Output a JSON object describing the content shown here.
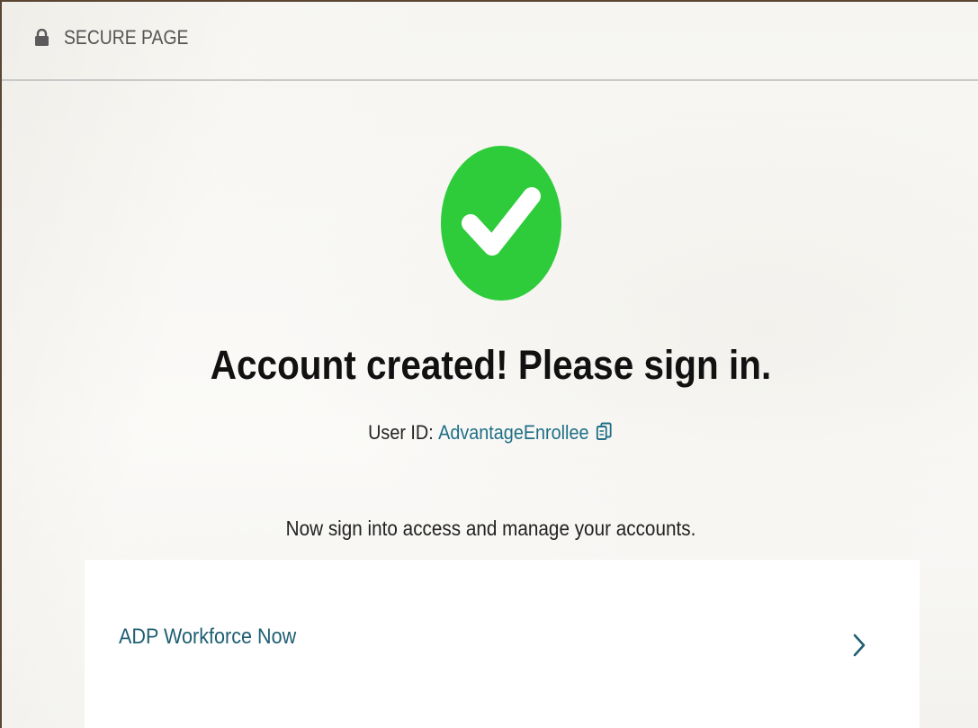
{
  "header": {
    "secure_label": "SECURE PAGE",
    "icon": "lock-icon"
  },
  "status": {
    "icon": "check-circle-icon",
    "color": "#2ecc3a"
  },
  "main": {
    "title": "Account created! Please sign in.",
    "user_id_label": "User ID:",
    "user_id_value": "AdvantageEnrollee",
    "copy_icon": "copy-icon",
    "subtitle": "Now sign into access and manage your accounts."
  },
  "accounts": [
    {
      "label": "ADP Workforce Now",
      "icon": "chevron-right-icon"
    }
  ],
  "colors": {
    "link": "#1f6f86",
    "success": "#2ecc3a",
    "text": "#111111"
  }
}
